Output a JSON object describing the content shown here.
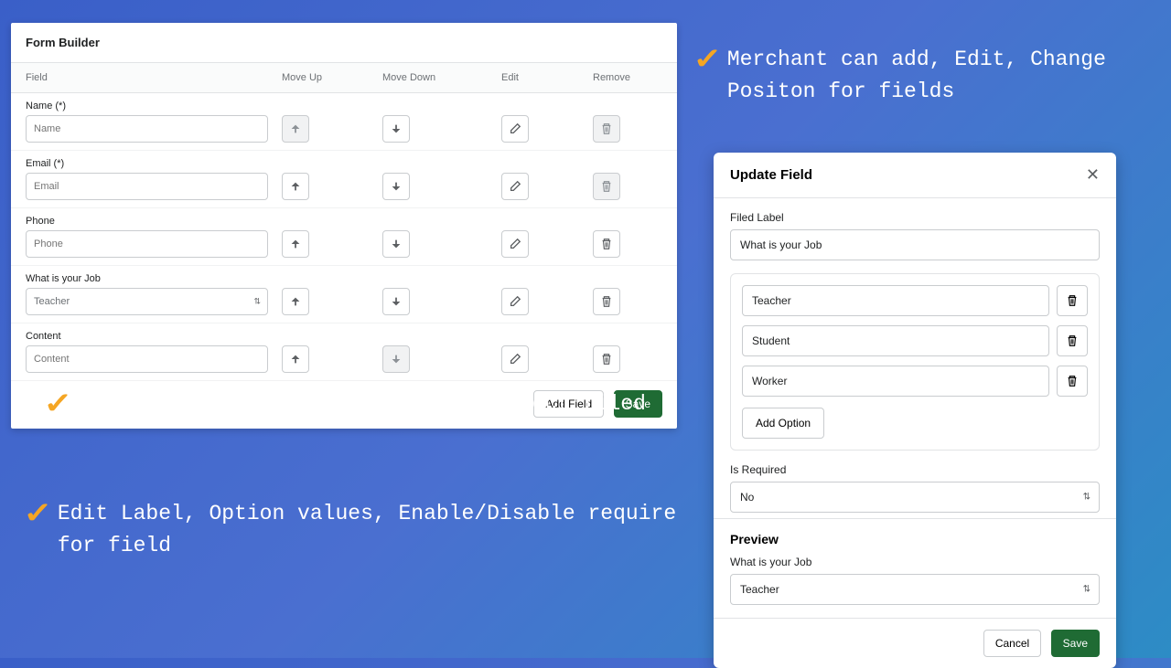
{
  "form_builder": {
    "title": "Form Builder",
    "columns": [
      "Field",
      "Move Up",
      "Move Down",
      "Edit",
      "Remove"
    ],
    "rows": [
      {
        "label": "Name (*)",
        "placeholder": "Name",
        "type": "text",
        "up_disabled": true,
        "remove_disabled": true
      },
      {
        "label": "Email (*)",
        "placeholder": "Email",
        "type": "text",
        "up_disabled": false,
        "remove_disabled": true
      },
      {
        "label": "Phone",
        "placeholder": "Phone",
        "type": "text",
        "up_disabled": false,
        "remove_disabled": false
      },
      {
        "label": "What is your Job",
        "value": "Teacher",
        "type": "select",
        "up_disabled": false,
        "remove_disabled": false
      },
      {
        "label": "Content",
        "placeholder": "Content",
        "type": "text",
        "up_disabled": false,
        "down_disabled": true,
        "remove_disabled": false
      }
    ],
    "add_field": "Add Field",
    "save": "Save"
  },
  "bullets": {
    "right_top": "Merchant can add, Edit, Change Positon for fields",
    "left1": "Support Text, Dropdown, Multiple Select filed",
    "left2": "Edit Label, Option values, Enable/Disable require for field"
  },
  "modal": {
    "title": "Update Field",
    "field_label_caption": "Filed Label",
    "field_label_value": "What is your Job",
    "options": [
      "Teacher",
      "Student",
      "Worker"
    ],
    "add_option": "Add Option",
    "is_required_label": "Is Required",
    "is_required_value": "No",
    "preview_title": "Preview",
    "preview_label": "What is your Job",
    "preview_value": "Teacher",
    "cancel": "Cancel",
    "save": "Save"
  }
}
